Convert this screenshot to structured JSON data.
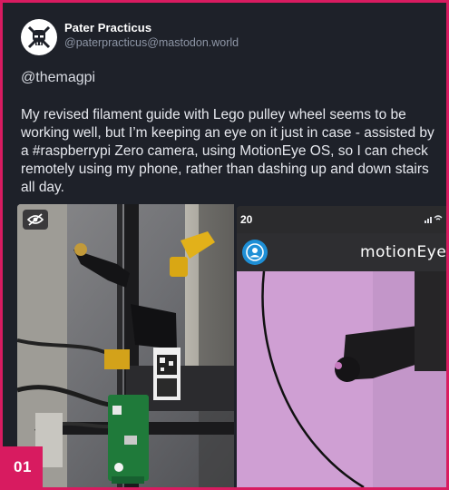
{
  "post": {
    "display_name": "Pater Practicus",
    "handle": "@paterpracticus@mastodon.world",
    "mention": "@themagpi",
    "body": "My revised filament guide with Lego pulley wheel seems to be working well, but I’m keeping an eye on it just in case - assisted by a #raspberrypi Zero camera, using MotionEye OS, so I can check remotely using my phone, rather than dashing up and down stairs all day."
  },
  "media": {
    "phone": {
      "time": "20",
      "app_title": "motionEye"
    }
  },
  "badge": "01",
  "colors": {
    "frame_border": "#d81b60",
    "card_background": "#1e2129",
    "badge": "#d81b60",
    "handle_text": "#8e96a6",
    "camera_view": "#d0a0d0"
  },
  "icons": [
    "mastodon-pirate-avatar-icon",
    "eye-slash-icon",
    "user-circle-icon",
    "signal-icon",
    "wifi-icon"
  ]
}
